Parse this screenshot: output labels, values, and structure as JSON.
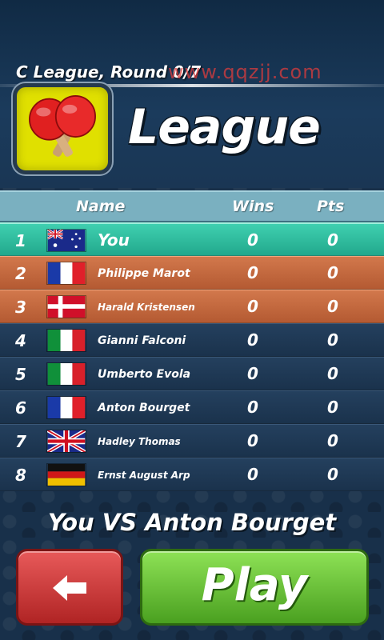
{
  "header": {
    "round_title": "C League, Round 0/7",
    "watermark": "www.qqzjj.com",
    "league_title": "League"
  },
  "table": {
    "columns": {
      "name": "Name",
      "wins": "Wins",
      "pts": "Pts"
    },
    "rows": [
      {
        "rank": "1",
        "flag": "australia-flag",
        "name": "You",
        "wins": "0",
        "pts": "0"
      },
      {
        "rank": "2",
        "flag": "france-flag",
        "name": "Philippe Marot",
        "wins": "0",
        "pts": "0"
      },
      {
        "rank": "3",
        "flag": "denmark-flag",
        "name": "Harald Kristensen",
        "wins": "0",
        "pts": "0"
      },
      {
        "rank": "4",
        "flag": "italy-flag",
        "name": "Gianni Falconi",
        "wins": "0",
        "pts": "0"
      },
      {
        "rank": "5",
        "flag": "italy-flag",
        "name": "Umberto Evola",
        "wins": "0",
        "pts": "0"
      },
      {
        "rank": "6",
        "flag": "france-flag",
        "name": "Anton Bourget",
        "wins": "0",
        "pts": "0"
      },
      {
        "rank": "7",
        "flag": "uk-flag",
        "name": "Hadley Thomas",
        "wins": "0",
        "pts": "0"
      },
      {
        "rank": "8",
        "flag": "germany-flag",
        "name": "Ernst August Arp",
        "wins": "0",
        "pts": "0"
      }
    ]
  },
  "match": {
    "versus": "You VS Anton Bourget"
  },
  "buttons": {
    "back_icon": "back-arrow-icon",
    "play_label": "Play"
  },
  "colors": {
    "player_row": "#2fbc9e",
    "promotion_row": "#c4683e",
    "normal_row": "#1f3a56",
    "back_button": "#c83232",
    "play_button": "#6cc23a",
    "logo_background": "#e0e000"
  }
}
